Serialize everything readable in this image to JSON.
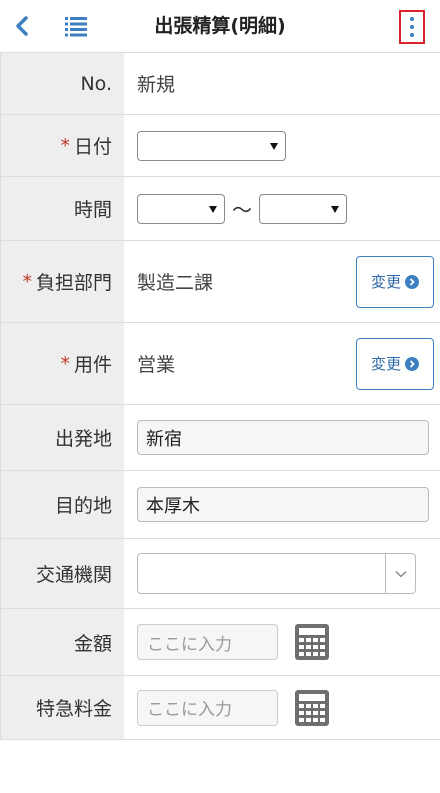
{
  "header": {
    "title": "出張精算(明細)",
    "accent": "#3e7fc1",
    "highlight": "#d9232f"
  },
  "form": {
    "required_mark": "*",
    "no": {
      "label": "No.",
      "value": "新規"
    },
    "date": {
      "label": "日付"
    },
    "time": {
      "label": "時間",
      "separator": "〜"
    },
    "department": {
      "label": "負担部門",
      "value": "製造二課",
      "button": "変更"
    },
    "purpose": {
      "label": "用件",
      "value": "営業",
      "button": "変更"
    },
    "origin": {
      "label": "出発地",
      "value": "新宿"
    },
    "destination": {
      "label": "目的地",
      "value": "本厚木"
    },
    "transport": {
      "label": "交通機関"
    },
    "amount": {
      "label": "金額",
      "placeholder": "ここに入力"
    },
    "express_fee": {
      "label": "特急料金",
      "placeholder": "ここに入力"
    }
  }
}
